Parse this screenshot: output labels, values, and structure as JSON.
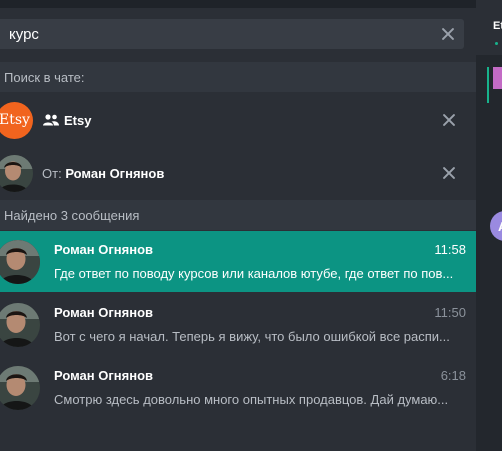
{
  "search": {
    "value": "курс"
  },
  "filters": {
    "header": "Поиск в чате:",
    "chat": {
      "avatar_text": "Etsy",
      "name": "Etsy",
      "icon": "people-icon"
    },
    "sender": {
      "prefix": "От:",
      "name": "Роман Огнянов"
    }
  },
  "results": {
    "header": "Найдено 3 сообщения",
    "items": [
      {
        "name": "Роман Огнянов",
        "time": "11:58",
        "text": "Где ответ по поводу курсов или каналов ютубе, где ответ по пов...",
        "active": true
      },
      {
        "name": "Роман Огнянов",
        "time": "11:50",
        "text": "Вот с чего я начал. Теперь я вижу, что было ошибкой все распи...",
        "active": false
      },
      {
        "name": "Роман Огнянов",
        "time": "6:18",
        "text": "Смотрю здесь довольно много опытных продавцов. Дай думаю...",
        "active": false
      }
    ]
  },
  "right_panel": {
    "title": "Et",
    "avatar_letter": "A"
  },
  "colors": {
    "accent": "#0c9483",
    "etsy": "#f1641e"
  }
}
